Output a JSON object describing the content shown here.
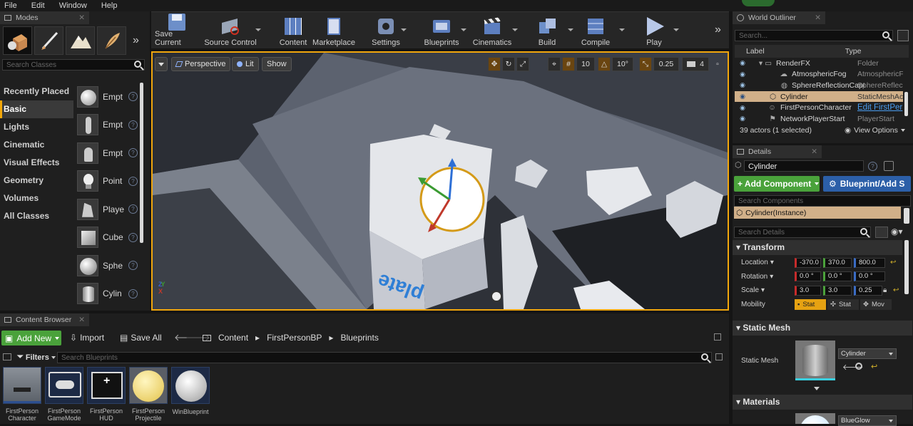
{
  "menu": [
    "File",
    "Edit",
    "Window",
    "Help"
  ],
  "modes_panel": {
    "title": "Modes",
    "search_placeholder": "Search Classes",
    "categories": [
      "Recently Placed",
      "Basic",
      "Lights",
      "Cinematic",
      "Visual Effects",
      "Geometry",
      "Volumes",
      "All Classes"
    ],
    "selected_category": "Basic",
    "items": [
      "Empt",
      "Empt",
      "Empt",
      "Point",
      "Playe",
      "Cube",
      "Sphe",
      "Cylin"
    ]
  },
  "toolbar": {
    "buttons": [
      "Save Current",
      "Source Control",
      "Content",
      "Marketplace",
      "Settings",
      "Blueprints",
      "Cinematics",
      "Build",
      "Compile",
      "Play"
    ]
  },
  "viewport": {
    "perspective": "Perspective",
    "lit": "Lit",
    "show": "Show",
    "grid_snap": "10",
    "rotation_snap": "10°",
    "scale_snap": "0.25",
    "camera_speed": "4",
    "floor_text": "plate"
  },
  "outliner": {
    "title": "World Outliner",
    "search_placeholder": "Search...",
    "col_label": "Label",
    "col_type": "Type",
    "rows": [
      {
        "label": "RenderFX",
        "type": "Folder"
      },
      {
        "label": "AtmosphericFog",
        "type": "AtmosphericF"
      },
      {
        "label": "SphereReflectionCapt",
        "type": "SphereReflec"
      },
      {
        "label": "Cylinder",
        "type": "StaticMeshAc"
      },
      {
        "label": "FirstPersonCharacter",
        "type": "Edit FirstPer"
      },
      {
        "label": "NetworkPlayerStart",
        "type": "PlayerStart"
      }
    ],
    "selected_row": 3,
    "status": "39 actors (1 selected)",
    "view_options": "View Options"
  },
  "details": {
    "title": "Details",
    "object_name": "Cylinder",
    "add_component": "+ Add Component",
    "blueprint_btn": "Blueprint/Add S",
    "search_components": "Search Components",
    "component_instance": "Cylinder(Instance)",
    "search_details": "Search Details",
    "transform_header": "Transform",
    "location_label": "Location",
    "location": [
      "-370.0",
      "370.0",
      "800.0"
    ],
    "rotation_label": "Rotation",
    "rotation": [
      "0.0 °",
      "0.0 °",
      "0.0 °"
    ],
    "scale_label": "Scale",
    "scale": [
      "3.0",
      "3.0",
      "0.25"
    ],
    "mobility_label": "Mobility",
    "mobility_options": [
      "Stat",
      "Stat",
      "Mov"
    ],
    "static_mesh_header": "Static Mesh",
    "static_mesh_label": "Static Mesh",
    "static_mesh_value": "Cylinder",
    "materials_header": "Materials",
    "material_value": "BlueGlow"
  },
  "content_browser": {
    "title": "Content Browser",
    "add_new": "Add New",
    "import": "Import",
    "save_all": "Save All",
    "path": [
      "Content",
      "FirstPersonBP",
      "Blueprints"
    ],
    "filters": "Filters",
    "search_placeholder": "Search Blueprints",
    "assets": [
      {
        "name_line1": "FirstPerson",
        "name_line2": "Character"
      },
      {
        "name_line1": "FirstPerson",
        "name_line2": "GameMode"
      },
      {
        "name_line1": "FirstPerson",
        "name_line2": "HUD"
      },
      {
        "name_line1": "FirstPerson",
        "name_line2": "Projectile"
      },
      {
        "name_line1": "WinBlueprint",
        "name_line2": ""
      }
    ]
  },
  "colors": {
    "accent_orange": "#f1a60c",
    "green_button": "#4aa23b",
    "blue_button": "#2c5fa8",
    "selection": "#d1b089"
  }
}
